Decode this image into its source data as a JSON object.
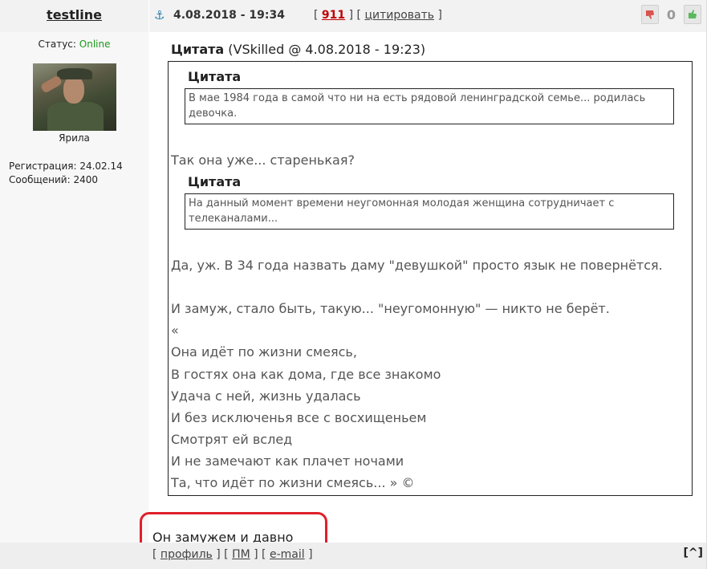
{
  "header": {
    "author": "testline",
    "date": "4.08.2018 - 19:34",
    "link_open": "[",
    "num": "911",
    "link_sep": "] [",
    "quote_link": "цитировать",
    "link_close": "]",
    "rating": "0"
  },
  "sidebar": {
    "status_label": "Статус:",
    "status_value": "Online",
    "username": "Ярила",
    "registration": "Регистрация: 24.02.14",
    "messages": "Сообщений: 2400"
  },
  "quote": {
    "label": "Цитата",
    "meta": "(VSkilled @ 4.08.2018 - 19:23)",
    "inner1_label": "Цитата",
    "inner1_text": "В мае 1984 года в самой что ни на есть рядовой ленинградской семье... родилась девочка.",
    "line1": "Так она уже... старенькая?",
    "inner2_label": "Цитата",
    "inner2_text": "На данный момент времени неугомонная молодая женщина сотрудничает с телеканалами...",
    "lines": [
      "Да, уж. В 34 года назвать даму \"девушкой\" просто язык не повернётся.",
      "И замуж, стало быть, такую... \"неугомонную\" — никто не берёт.",
      "«",
      "Она идёт по жизни смеясь,",
      "В гостях она как дома, где все знакомо",
      "Удача с ней, жизнь удалась",
      "И без исключенья все с восхищеньем",
      "Смотрят ей вслед",
      "И не замечают как плачет ночами",
      "Та, что идёт по жизни смеясь... » ©"
    ]
  },
  "reply": "Он замужем и давно",
  "footer": {
    "open": "[",
    "profile": "профиль",
    "sep1": "] [",
    "pm": "ПМ",
    "sep2": "] [",
    "email": "e-mail",
    "close": "]",
    "up": "[^]"
  },
  "icons": {
    "anchor": "anchor-icon",
    "thumb_down": "thumb-down-icon",
    "thumb_up": "thumb-up-icon"
  },
  "colors": {
    "online": "#1a9a1a",
    "post_number": "#c00000",
    "highlight": "#e0202a",
    "thumb_down": "#d9534f",
    "thumb_up": "#5cb85c"
  }
}
